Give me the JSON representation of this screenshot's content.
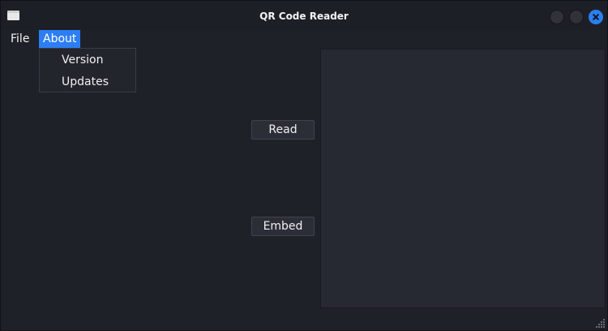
{
  "window": {
    "title": "QR Code Reader"
  },
  "icons": {
    "app": "app-window-icon",
    "minimize": "minimize-icon",
    "maximize": "maximize-icon",
    "close": "close-icon",
    "resize": "resize-grip-icon"
  },
  "colors": {
    "accent": "#2d7ef5",
    "background": "#1f2128",
    "panel": "#262832"
  },
  "menubar": {
    "file": "File",
    "about": "About"
  },
  "about_menu": {
    "items": [
      {
        "label": "Version"
      },
      {
        "label": "Updates"
      }
    ]
  },
  "buttons": {
    "read": "Read",
    "embed": "Embed"
  }
}
